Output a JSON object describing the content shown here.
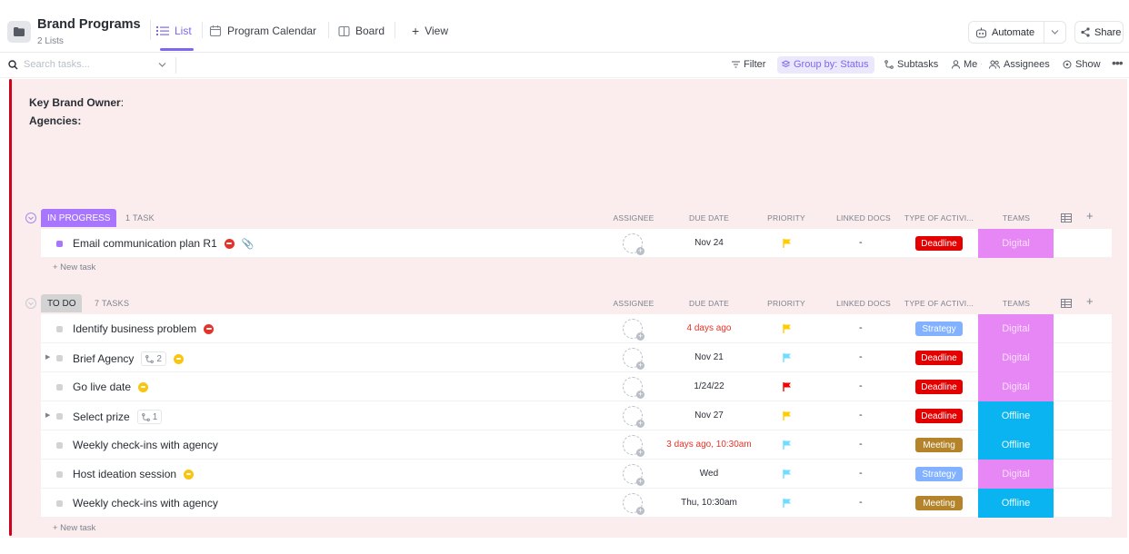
{
  "header": {
    "title": "Brand Programs",
    "subtitle": "2 Lists",
    "tabs": [
      {
        "label": "List",
        "active": true
      },
      {
        "label": "Program Calendar",
        "active": false
      },
      {
        "label": "Board",
        "active": false
      }
    ],
    "add_view_label": "View",
    "automate_label": "Automate",
    "share_label": "Share"
  },
  "toolbar": {
    "search_placeholder": "Search tasks...",
    "filter": "Filter",
    "group_by": "Group by: Status",
    "subtasks": "Subtasks",
    "me": "Me",
    "assignees": "Assignees",
    "show": "Show"
  },
  "description": {
    "line1": "Key Brand Owner",
    "line1_suffix": ":",
    "line2": "Agencies:"
  },
  "columns": {
    "assignee": "ASSIGNEE",
    "due_date": "DUE DATE",
    "priority": "PRIORITY",
    "linked_docs": "LINKED DOCS",
    "type": "TYPE OF ACTIVI...",
    "teams": "TEAMS"
  },
  "groups": [
    {
      "status": "IN PROGRESS",
      "status_color": "#a875ff",
      "count": "1 TASK",
      "new_task": "+ New task",
      "tasks": [
        {
          "name": "Email communication plan R1",
          "due": "Nov 24",
          "overdue": false,
          "priority_color": "#ffcc00",
          "linked": "-",
          "type": "Deadline",
          "type_color": "#e50000",
          "team": "Digital",
          "team_color": "#e787f5",
          "team_text": "#fbe1fd",
          "dot_color": "#a875ff",
          "expand": false,
          "subtasks": "",
          "badge": "red",
          "clip": true
        }
      ]
    },
    {
      "status": "TO DO",
      "status_color": "#d3d3d3",
      "count": "7 TASKS",
      "new_task": "+ New task",
      "tasks": [
        {
          "name": "Identify business problem",
          "due": "4 days ago",
          "overdue": true,
          "priority_color": "#ffcc00",
          "linked": "-",
          "type": "Strategy",
          "type_color": "#81b1ff",
          "team": "Digital",
          "team_color": "#e787f5",
          "team_text": "#fbe1fd",
          "dot_color": "#d3d3d3",
          "expand": false,
          "subtasks": "",
          "badge": "red",
          "clip": false
        },
        {
          "name": "Brief Agency",
          "due": "Nov 21",
          "overdue": false,
          "priority_color": "#6fddff",
          "linked": "-",
          "type": "Deadline",
          "type_color": "#e50000",
          "team": "Digital",
          "team_color": "#e787f5",
          "team_text": "#fbe1fd",
          "dot_color": "#d3d3d3",
          "expand": true,
          "subtasks": "2",
          "badge": "yellow",
          "clip": false
        },
        {
          "name": "Go live date",
          "due": "1/24/22",
          "overdue": false,
          "priority_color": "#f50000",
          "linked": "-",
          "type": "Deadline",
          "type_color": "#e50000",
          "team": "Digital",
          "team_color": "#e787f5",
          "team_text": "#fbe1fd",
          "dot_color": "#d3d3d3",
          "expand": false,
          "subtasks": "",
          "badge": "yellow",
          "clip": false
        },
        {
          "name": "Select prize",
          "due": "Nov 27",
          "overdue": false,
          "priority_color": "#ffcc00",
          "linked": "-",
          "type": "Deadline",
          "type_color": "#e50000",
          "team": "Offline",
          "team_color": "#0ab4f0",
          "team_text": "#e6f7ff",
          "dot_color": "#d3d3d3",
          "expand": true,
          "subtasks": "1",
          "badge": "",
          "clip": false
        },
        {
          "name": "Weekly check-ins with agency",
          "due": "3 days ago, 10:30am",
          "overdue": true,
          "priority_color": "#6fddff",
          "linked": "-",
          "type": "Meeting",
          "type_color": "#b5832a",
          "team": "Offline",
          "team_color": "#0ab4f0",
          "team_text": "#e6f7ff",
          "dot_color": "#d3d3d3",
          "expand": false,
          "subtasks": "",
          "badge": "",
          "clip": false
        },
        {
          "name": "Host ideation session",
          "due": "Wed",
          "overdue": false,
          "priority_color": "#6fddff",
          "linked": "-",
          "type": "Strategy",
          "type_color": "#81b1ff",
          "team": "Digital",
          "team_color": "#e787f5",
          "team_text": "#fbe1fd",
          "dot_color": "#d3d3d3",
          "expand": false,
          "subtasks": "",
          "badge": "yellow",
          "clip": false
        },
        {
          "name": "Weekly check-ins with agency",
          "due": "Thu, 10:30am",
          "overdue": false,
          "priority_color": "#6fddff",
          "linked": "-",
          "type": "Meeting",
          "type_color": "#b5832a",
          "team": "Offline",
          "team_color": "#0ab4f0",
          "team_text": "#e6f7ff",
          "dot_color": "#d3d3d3",
          "expand": false,
          "subtasks": "",
          "badge": "",
          "clip": false
        }
      ]
    }
  ]
}
